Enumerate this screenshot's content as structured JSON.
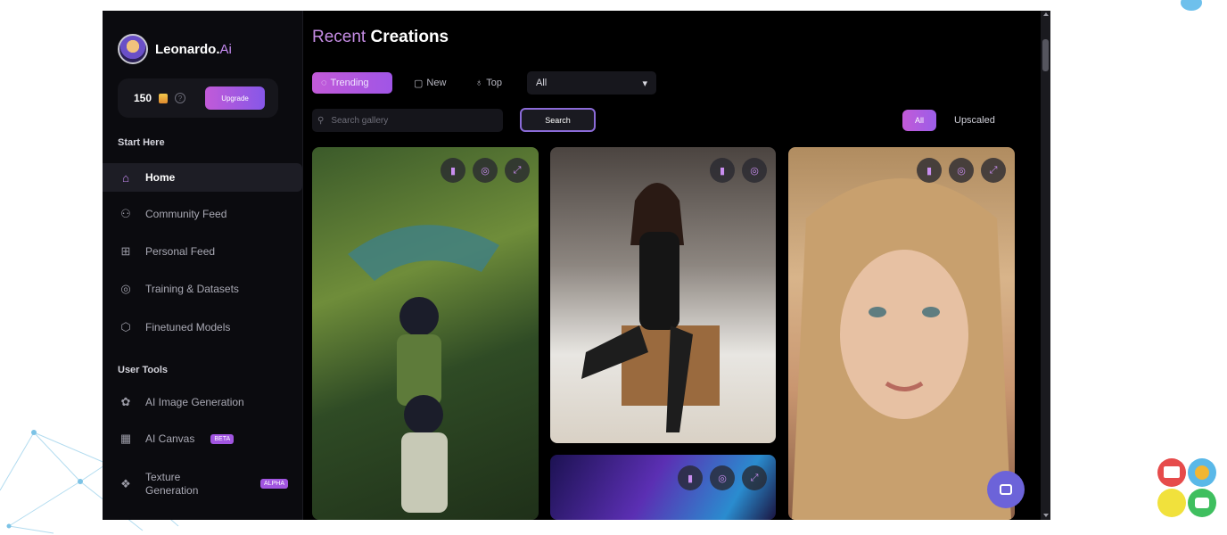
{
  "sidebar": {
    "brand": {
      "name": "Leonardo.",
      "suffix": "Ai"
    },
    "credits": {
      "value": "150",
      "upgrade_label": "Upgrade"
    },
    "section_start": "Start Here",
    "section_tools": "User Tools",
    "items": [
      {
        "label": "Home",
        "icon": "home-icon"
      },
      {
        "label": "Community Feed",
        "icon": "community-icon"
      },
      {
        "label": "Personal Feed",
        "icon": "grid-icon"
      },
      {
        "label": "Training & Datasets",
        "icon": "training-icon"
      },
      {
        "label": "Finetuned Models",
        "icon": "cube-icon"
      }
    ],
    "tools": [
      {
        "label": "AI Image Generation",
        "icon": "palette-icon"
      },
      {
        "label": "AI Canvas",
        "badge": "BETA",
        "icon": "canvas-icon"
      },
      {
        "label_line1": "Texture",
        "label_line2": "Generation",
        "badge": "ALPHA",
        "icon": "texture-icon"
      }
    ]
  },
  "main": {
    "heading_accent": "Recent",
    "heading_rest": "Creations",
    "tabs": [
      {
        "label": "Trending",
        "icon": "flame-icon"
      },
      {
        "label": "New",
        "icon": "square-icon"
      },
      {
        "label": "Top",
        "icon": "top-icon"
      }
    ],
    "filter_value": "All",
    "search": {
      "placeholder": "Search gallery",
      "button": "Search"
    },
    "segments": {
      "all": "All",
      "upscaled": "Upscaled"
    }
  }
}
